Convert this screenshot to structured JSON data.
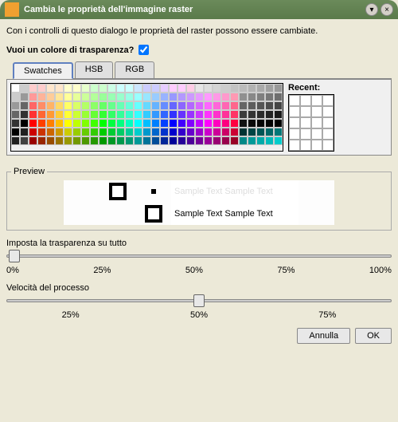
{
  "title": "Cambia le proprietà dell'immagine raster",
  "intro": "Con i controlli di questo dialogo le proprietà del raster possono essere cambiate.",
  "transparency_question": "Vuoi un colore di trasparenza?",
  "transparency_checked": true,
  "tabs": {
    "swatches": "Swatches",
    "hsb": "HSB",
    "rgb": "RGB"
  },
  "recent_label": "Recent:",
  "preview_label": "Preview",
  "sample_text": "Sample Text Sample Text",
  "sample_text2": "Sample Text  Sample Text",
  "slider1": {
    "label": "Imposta la trasparenza su tutto",
    "value": 0,
    "ticks": [
      "0%",
      "25%",
      "50%",
      "75%",
      "100%"
    ]
  },
  "slider2": {
    "label": "Velocità del processo",
    "value": 50,
    "ticks": [
      "25%",
      "50%",
      "75%"
    ]
  },
  "buttons": {
    "cancel": "Annulla",
    "ok": "OK"
  },
  "swatch_rows": [
    [
      "#ffffff",
      "#cccccc",
      "#ffcccc",
      "#ffcccc",
      "#ffe6cc",
      "#ffe6cc",
      "#ffffcc",
      "#ffffcc",
      "#e6ffcc",
      "#ccffcc",
      "#ccffcc",
      "#ccffe6",
      "#ccffff",
      "#ccffff",
      "#cce6ff",
      "#ccccff",
      "#ccccff",
      "#e6ccff",
      "#ffccff",
      "#ffccff",
      "#ffcce6",
      "#e6e6e6",
      "#dddddd",
      "#d4d4d4",
      "#cccccc",
      "#c3c3c3",
      "#bbbbbb",
      "#b2b2b2",
      "#aaaaaa",
      "#a1a1a1",
      "#999999"
    ],
    [
      "#cccccc",
      "#999999",
      "#ff9999",
      "#ffb399",
      "#ffcc99",
      "#ffe699",
      "#ffff99",
      "#e6ff99",
      "#ccff99",
      "#b3ff99",
      "#99ff99",
      "#99ffb3",
      "#99ffcc",
      "#99ffe6",
      "#99ffff",
      "#99e6ff",
      "#99ccff",
      "#99b3ff",
      "#9999ff",
      "#b399ff",
      "#cc99ff",
      "#e699ff",
      "#ff99ff",
      "#ff99e6",
      "#ff99cc",
      "#ff99b3",
      "#909090",
      "#888888",
      "#7f7f7f",
      "#777777",
      "#6e6e6e"
    ],
    [
      "#999999",
      "#666666",
      "#ff6666",
      "#ff8c66",
      "#ffb366",
      "#ffd966",
      "#ffff66",
      "#d9ff66",
      "#b3ff66",
      "#8cff66",
      "#66ff66",
      "#66ff8c",
      "#66ffb3",
      "#66ffd9",
      "#66ffff",
      "#66d9ff",
      "#66b3ff",
      "#668cff",
      "#6666ff",
      "#8c66ff",
      "#b366ff",
      "#d966ff",
      "#ff66ff",
      "#ff66d9",
      "#ff66b3",
      "#ff668c",
      "#666666",
      "#5d5d5d",
      "#555555",
      "#4c4c4c",
      "#444444"
    ],
    [
      "#666666",
      "#333333",
      "#ff3333",
      "#ff6633",
      "#ff9933",
      "#ffcc33",
      "#ffff33",
      "#ccff33",
      "#99ff33",
      "#66ff33",
      "#33ff33",
      "#33ff66",
      "#33ff99",
      "#33ffcc",
      "#33ffff",
      "#33ccff",
      "#3399ff",
      "#3366ff",
      "#3333ff",
      "#6633ff",
      "#9933ff",
      "#cc33ff",
      "#ff33ff",
      "#ff33cc",
      "#ff3399",
      "#ff3366",
      "#3b3b3b",
      "#333333",
      "#2a2a2a",
      "#222222",
      "#191919"
    ],
    [
      "#333333",
      "#000000",
      "#ff0000",
      "#ff4000",
      "#ff8000",
      "#ffbf00",
      "#ffff00",
      "#bfff00",
      "#80ff00",
      "#40ff00",
      "#00ff00",
      "#00ff40",
      "#00ff80",
      "#00ffbf",
      "#00ffff",
      "#00bfff",
      "#0080ff",
      "#0040ff",
      "#0000ff",
      "#4000ff",
      "#8000ff",
      "#bf00ff",
      "#ff00ff",
      "#ff00bf",
      "#ff0080",
      "#ff0040",
      "#111111",
      "#0a0a0a",
      "#050505",
      "#020202",
      "#000000"
    ],
    [
      "#000000",
      "#202020",
      "#cc0000",
      "#cc3300",
      "#cc6600",
      "#cc9900",
      "#cccc00",
      "#99cc00",
      "#66cc00",
      "#33cc00",
      "#00cc00",
      "#00cc33",
      "#00cc66",
      "#00cc99",
      "#00cccc",
      "#0099cc",
      "#0066cc",
      "#0033cc",
      "#0000cc",
      "#3300cc",
      "#6600cc",
      "#9900cc",
      "#cc00cc",
      "#cc0099",
      "#cc0066",
      "#cc0033",
      "#003333",
      "#004444",
      "#005555",
      "#006666",
      "#007777"
    ],
    [
      "#202020",
      "#404040",
      "#990000",
      "#992600",
      "#994d00",
      "#997300",
      "#999900",
      "#739900",
      "#4d9900",
      "#269900",
      "#009900",
      "#009926",
      "#00994d",
      "#009973",
      "#009999",
      "#007399",
      "#004d99",
      "#002699",
      "#000099",
      "#260099",
      "#4d0099",
      "#730099",
      "#990099",
      "#990073",
      "#99004d",
      "#990026",
      "#008888",
      "#009999",
      "#00aaaa",
      "#00bbbb",
      "#00cccc"
    ]
  ]
}
